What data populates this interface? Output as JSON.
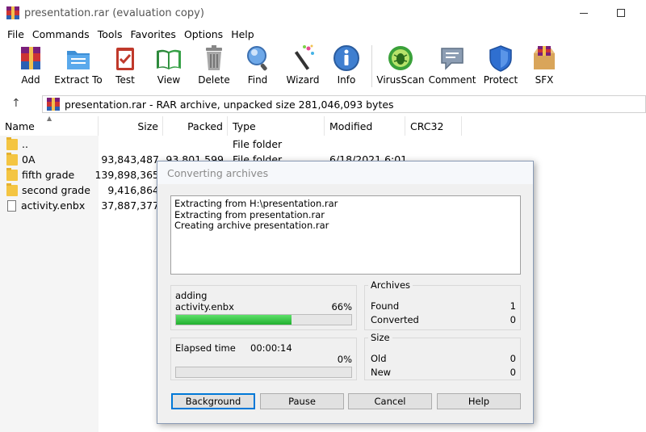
{
  "window": {
    "title": "presentation.rar (evaluation copy)"
  },
  "menu": [
    "File",
    "Commands",
    "Tools",
    "Favorites",
    "Options",
    "Help"
  ],
  "toolbar": {
    "add": "Add",
    "extract_to": "Extract To",
    "test": "Test",
    "view": "View",
    "delete": "Delete",
    "find": "Find",
    "wizard": "Wizard",
    "info": "Info",
    "virusscan": "VirusScan",
    "comment": "Comment",
    "protect": "Protect",
    "sfx": "SFX"
  },
  "address": {
    "text": "presentation.rar - RAR archive, unpacked size 281,046,093 bytes"
  },
  "columns": {
    "name": "Name",
    "size": "Size",
    "packed": "Packed",
    "type": "Type",
    "modified": "Modified",
    "crc32": "CRC32"
  },
  "files": [
    {
      "name": "..",
      "size": "",
      "packed": "",
      "type": "File folder",
      "modified": "",
      "icon": "folder-icon"
    },
    {
      "name": "0A",
      "size": "93,843,487",
      "packed": "93,801,599",
      "type": "File folder",
      "modified": "6/18/2021 6:01",
      "icon": "folder-icon"
    },
    {
      "name": "fifth grade",
      "size": "139,898,365",
      "packed": "",
      "type": "",
      "modified": "",
      "icon": "folder-icon"
    },
    {
      "name": "second grade",
      "size": "9,416,864",
      "packed": "",
      "type": "",
      "modified": "",
      "icon": "folder-icon"
    },
    {
      "name": "activity.enbx",
      "size": "37,887,377",
      "packed": "",
      "type": "",
      "modified": "",
      "icon": "file-icon"
    }
  ],
  "dialog": {
    "title": "Converting archives",
    "log": [
      "Extracting from H:\\presentation.rar",
      "Extracting from presentation.rar",
      "Creating archive presentation.rar"
    ],
    "action": "adding",
    "current_file": "activity.enbx",
    "file_percent": "66%",
    "file_progress": 0.66,
    "elapsed_label": "Elapsed time",
    "elapsed_value": "00:00:14",
    "total_percent": "0%",
    "total_progress": 0.0,
    "archives": {
      "title": "Archives",
      "found_label": "Found",
      "found_value": "1",
      "converted_label": "Converted",
      "converted_value": "0"
    },
    "size": {
      "title": "Size",
      "old_label": "Old",
      "old_value": "0",
      "new_label": "New",
      "new_value": "0"
    },
    "buttons": {
      "background": "Background",
      "pause": "Pause",
      "cancel": "Cancel",
      "help": "Help"
    }
  },
  "colors": {
    "progress_green": "#21b02f",
    "default_button_border": "#0078d7"
  }
}
